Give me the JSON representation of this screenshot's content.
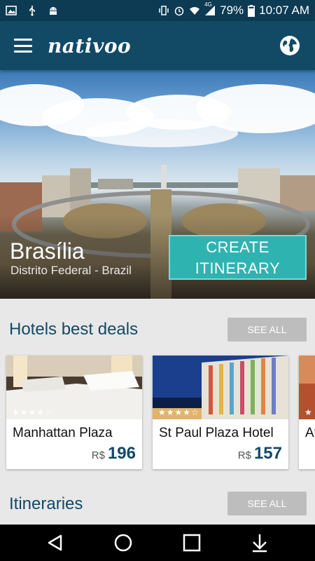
{
  "status_bar": {
    "battery": "79%",
    "time": "10:07 AM",
    "network": "4G",
    "icons": [
      "image-icon",
      "usb-icon",
      "android-icon",
      "vibrate-icon",
      "alarm-icon",
      "wifi-icon",
      "signal-icon",
      "battery-icon"
    ]
  },
  "app_bar": {
    "logo": "nativoo",
    "menu_icon": "hamburger-menu-icon",
    "globe_icon": "globe-icon"
  },
  "hero": {
    "city": "Brasília",
    "region": "Distrito Federal - Brazil",
    "cta_line1": "CREATE",
    "cta_line2": "ITINERARY"
  },
  "hotels": {
    "title": "Hotels best deals",
    "see_all": "SEE ALL",
    "cards": [
      {
        "name": "Manhattan Plaza",
        "currency": "R$",
        "price": "196",
        "stars": 4
      },
      {
        "name": "St Paul Plaza Hotel",
        "currency": "R$",
        "price": "157",
        "stars": 4
      },
      {
        "name": "At",
        "currency": "",
        "price": "",
        "stars": 1
      }
    ]
  },
  "itineraries": {
    "title": "Itineraries",
    "see_all": "SEE ALL"
  },
  "nav_bar": {
    "icons": [
      "back-icon",
      "home-icon",
      "recents-icon",
      "download-icon"
    ]
  },
  "colors": {
    "status_bar": "#0d3b53",
    "app_bar": "#124a66",
    "accent": "#2fb3b1",
    "button_grey": "#bdbdbd"
  }
}
